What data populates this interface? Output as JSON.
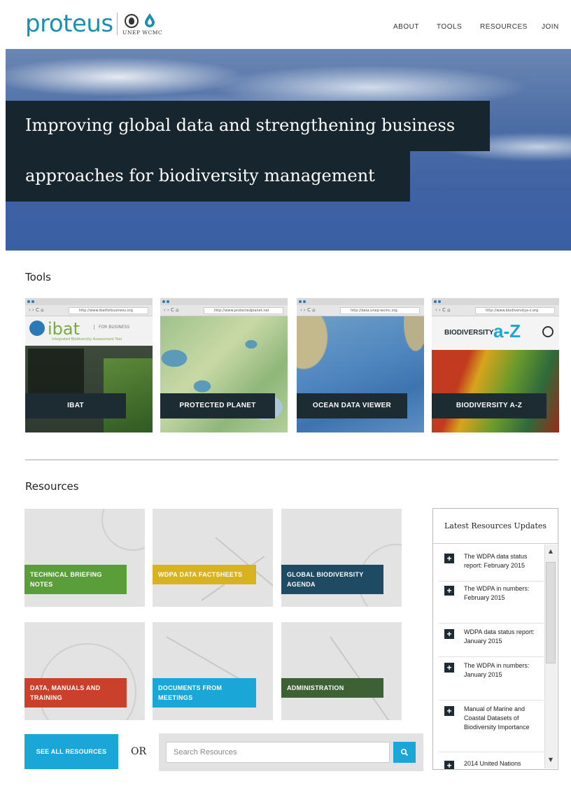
{
  "header": {
    "logo_text": "proteus",
    "partner_text": "UNEP WCMC",
    "nav": [
      {
        "label": "ABOUT"
      },
      {
        "label": "TOOLS"
      },
      {
        "label": "RESOURCES"
      },
      {
        "label": "JOIN"
      }
    ]
  },
  "hero": {
    "line1": "Improving global data and strengthening business",
    "line2": "approaches for biodiversity management"
  },
  "tools": {
    "title": "Tools",
    "cards": [
      {
        "label": "IBAT",
        "url": "http://www.ibatforbusiness.org",
        "brand": "ibat",
        "brand_sub": "FOR BUSINESS",
        "brand_caption": "Integrated Biodiversity Assessment Tool"
      },
      {
        "label": "PROTECTED PLANET",
        "url": "http://www.protectedplanet.net"
      },
      {
        "label": "OCEAN DATA VIEWER",
        "url": "http://data.unep-wcmc.org"
      },
      {
        "label": "BIODIVERSITY A-Z",
        "url": "http://www.biodiversitya-z.org",
        "brand": "BIODIVERSITY",
        "brand_big": "a-Z"
      }
    ]
  },
  "resources": {
    "title": "Resources",
    "tiles": [
      {
        "label": "TECHNICAL BRIEFING NOTES",
        "color": "#5a9e3a"
      },
      {
        "label": "WDPA DATA FACTSHEETS",
        "color": "#d9b21f"
      },
      {
        "label": "GLOBAL BIODIVERSITY AGENDA",
        "color": "#1e4a63"
      },
      {
        "label": "DATA, MANUALS AND TRAINING",
        "color": "#c9412b"
      },
      {
        "label": "DOCUMENTS FROM MEETINGS",
        "color": "#1aa7d8"
      },
      {
        "label": "ADMINISTRATION",
        "color": "#3d6135"
      }
    ],
    "see_all_label": "SEE ALL RESOURCES",
    "or_text": "OR",
    "search_placeholder": "Search Resources"
  },
  "updates": {
    "title": "Latest Resources Updates",
    "items": [
      {
        "text": "The WDPA data status report: February 2015"
      },
      {
        "text": "The WDPA in numbers: February 2015"
      },
      {
        "text": "WDPA data status report: January 2015"
      },
      {
        "text": "The WDPA in numbers: January 2015"
      },
      {
        "text": "Manual of Marine and Coastal Datasets of Biodiversity Importance"
      },
      {
        "text": "2014 United Nations"
      }
    ]
  }
}
